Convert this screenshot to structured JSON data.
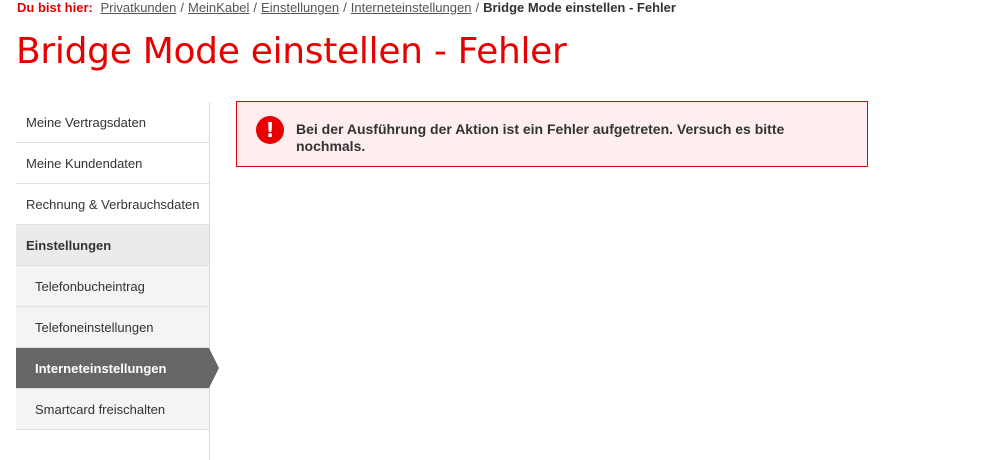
{
  "breadcrumb": {
    "prefix": "Du bist hier:",
    "items": [
      "Privatkunden",
      "MeinKabel",
      "Einstellungen",
      "Interneteinstellungen"
    ],
    "separator": "/",
    "current": "Bridge Mode einstellen - Fehler"
  },
  "page_title": "Bridge Mode einstellen - Fehler",
  "sidebar": {
    "items": [
      {
        "label": "Meine Vertragsdaten"
      },
      {
        "label": "Meine Kundendaten"
      },
      {
        "label": "Rechnung & Verbrauchsdaten"
      },
      {
        "label": "Einstellungen"
      },
      {
        "label": "Telefonbucheintrag"
      },
      {
        "label": "Telefoneinstellungen"
      },
      {
        "label": "Interneteinstellungen"
      },
      {
        "label": "Smartcard freischalten"
      }
    ]
  },
  "error": {
    "icon": "!",
    "message": "Bei der Ausführung der Aktion ist ein Fehler aufgetreten. Versuch es bitte nochmals."
  },
  "colors": {
    "brand_red": "#e60000",
    "active_nav": "#666666",
    "error_background": "#feeeef"
  }
}
